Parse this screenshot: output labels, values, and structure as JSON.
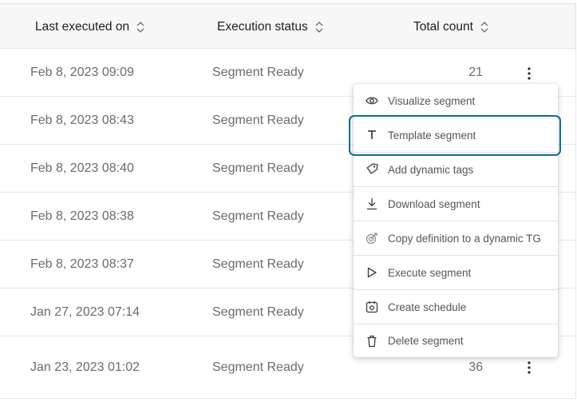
{
  "table": {
    "headers": {
      "last_executed": "Last executed on",
      "execution_status": "Execution status",
      "total_count": "Total count"
    },
    "rows": [
      {
        "date": "Feb 8, 2023 09:09",
        "status": "Segment Ready",
        "count": "21"
      },
      {
        "date": "Feb 8, 2023 08:43",
        "status": "Segment Ready",
        "count": ""
      },
      {
        "date": "Feb 8, 2023 08:40",
        "status": "Segment Ready",
        "count": ""
      },
      {
        "date": "Feb 8, 2023 08:38",
        "status": "Segment Ready",
        "count": ""
      },
      {
        "date": "Feb 8, 2023 08:37",
        "status": "Segment Ready",
        "count": ""
      },
      {
        "date": "Jan 27, 2023 07:14",
        "status": "Segment Ready",
        "count": ""
      },
      {
        "date": "Jan 23, 2023 01:02",
        "status": "Segment Ready",
        "count": "36"
      }
    ]
  },
  "menu": {
    "focused_item": "Template segment",
    "items": [
      {
        "label": "Visualize segment",
        "icon": "eye-icon"
      },
      {
        "label": "Template segment",
        "icon": "text-t-icon"
      },
      {
        "label": "Add dynamic tags",
        "icon": "tag-icon"
      },
      {
        "label": "Download segment",
        "icon": "download-icon"
      },
      {
        "label": "Copy definition to a dynamic TG",
        "icon": "target-icon"
      },
      {
        "label": "Execute segment",
        "icon": "play-icon"
      },
      {
        "label": "Create schedule",
        "icon": "calendar-gear-icon"
      },
      {
        "label": "Delete segment",
        "icon": "trash-icon"
      }
    ]
  },
  "colors": {
    "header_bg": "#f7f7f8",
    "focus_ring": "#0f6e8c",
    "text_primary": "#1f1f23",
    "text_secondary": "#6a6a70"
  }
}
